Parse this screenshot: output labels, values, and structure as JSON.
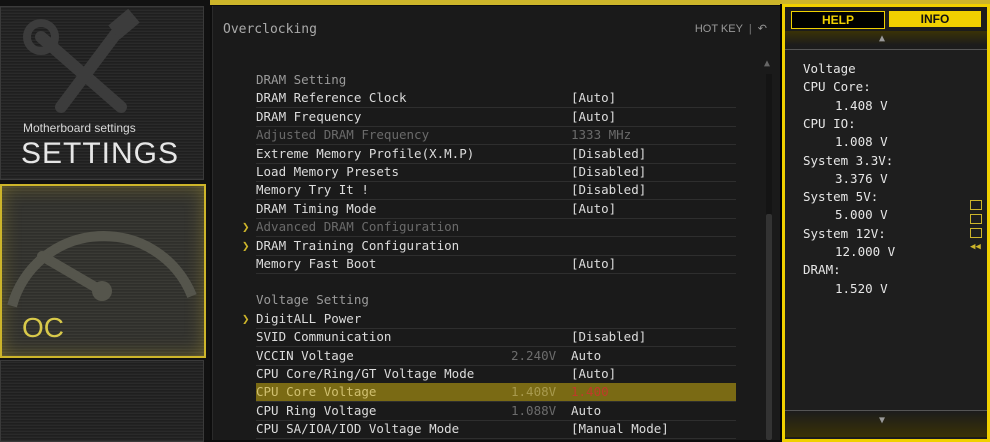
{
  "sidebar": {
    "settings": {
      "subtitle": "Motherboard settings",
      "title": "SETTINGS"
    },
    "oc": {
      "title": "OC"
    }
  },
  "main": {
    "title": "Overclocking",
    "hotkey_label": "HOT KEY",
    "hotkey_sep": "|",
    "back_icon": "↶"
  },
  "rows": [
    {
      "label": "DRAM Setting",
      "kind": "header"
    },
    {
      "label": "DRAM Reference Clock",
      "value": "[Auto]"
    },
    {
      "label": "DRAM Frequency",
      "value": "[Auto]"
    },
    {
      "label": "Adjusted DRAM Frequency",
      "value": "1333 MHz",
      "kind": "dim"
    },
    {
      "label": "Extreme Memory Profile(X.M.P)",
      "value": "[Disabled]"
    },
    {
      "label": "Load Memory Presets",
      "value": "[Disabled]"
    },
    {
      "label": "Memory Try It !",
      "value": "[Disabled]"
    },
    {
      "label": "DRAM Timing Mode",
      "value": "[Auto]"
    },
    {
      "label": "Advanced DRAM Configuration",
      "kind": "dim",
      "arrow": true
    },
    {
      "label": "DRAM Training Configuration",
      "arrow": true
    },
    {
      "label": "Memory Fast Boot",
      "value": "[Auto]"
    },
    {
      "label": "Voltage Setting",
      "kind": "header"
    },
    {
      "label": "DigitALL Power",
      "arrow": true
    },
    {
      "label": "SVID Communication",
      "value": "[Disabled]"
    },
    {
      "label": "VCCIN Voltage",
      "current": "2.240V",
      "value": "Auto"
    },
    {
      "label": "CPU Core/Ring/GT Voltage Mode",
      "value": "[Auto]"
    },
    {
      "label": "CPU Core Voltage",
      "current": "1.408V",
      "value": "1.400",
      "kind": "selected"
    },
    {
      "label": "CPU Ring Voltage",
      "current": "1.088V",
      "value": "Auto"
    },
    {
      "label": "CPU SA/IOA/IOD Voltage Mode",
      "value": "[Manual Mode]"
    }
  ],
  "info_panel": {
    "tab_help": "HELP",
    "tab_info": "INFO",
    "lines": [
      {
        "text": "Voltage"
      },
      {
        "text": "CPU Core:"
      },
      {
        "text": "1.408 V",
        "value": true
      },
      {
        "text": "CPU IO:"
      },
      {
        "text": "1.008 V",
        "value": true
      },
      {
        "text": "System 3.3V:"
      },
      {
        "text": "3.376 V",
        "value": true
      },
      {
        "text": "System 5V:"
      },
      {
        "text": "5.000 V",
        "value": true
      },
      {
        "text": "System 12V:"
      },
      {
        "text": "12.000 V",
        "value": true
      },
      {
        "text": "DRAM:"
      },
      {
        "text": "1.520 V",
        "value": true
      }
    ]
  },
  "colors": {
    "accent": "#cdb52a",
    "info_accent": "#f0d000",
    "selected_row": "#7a6a14",
    "new_value": "#c03a2a"
  },
  "icons": {
    "hotkey_back": "undo-icon",
    "submenu": "chevron-right-icon",
    "scroll": "triangle-up-icon"
  }
}
